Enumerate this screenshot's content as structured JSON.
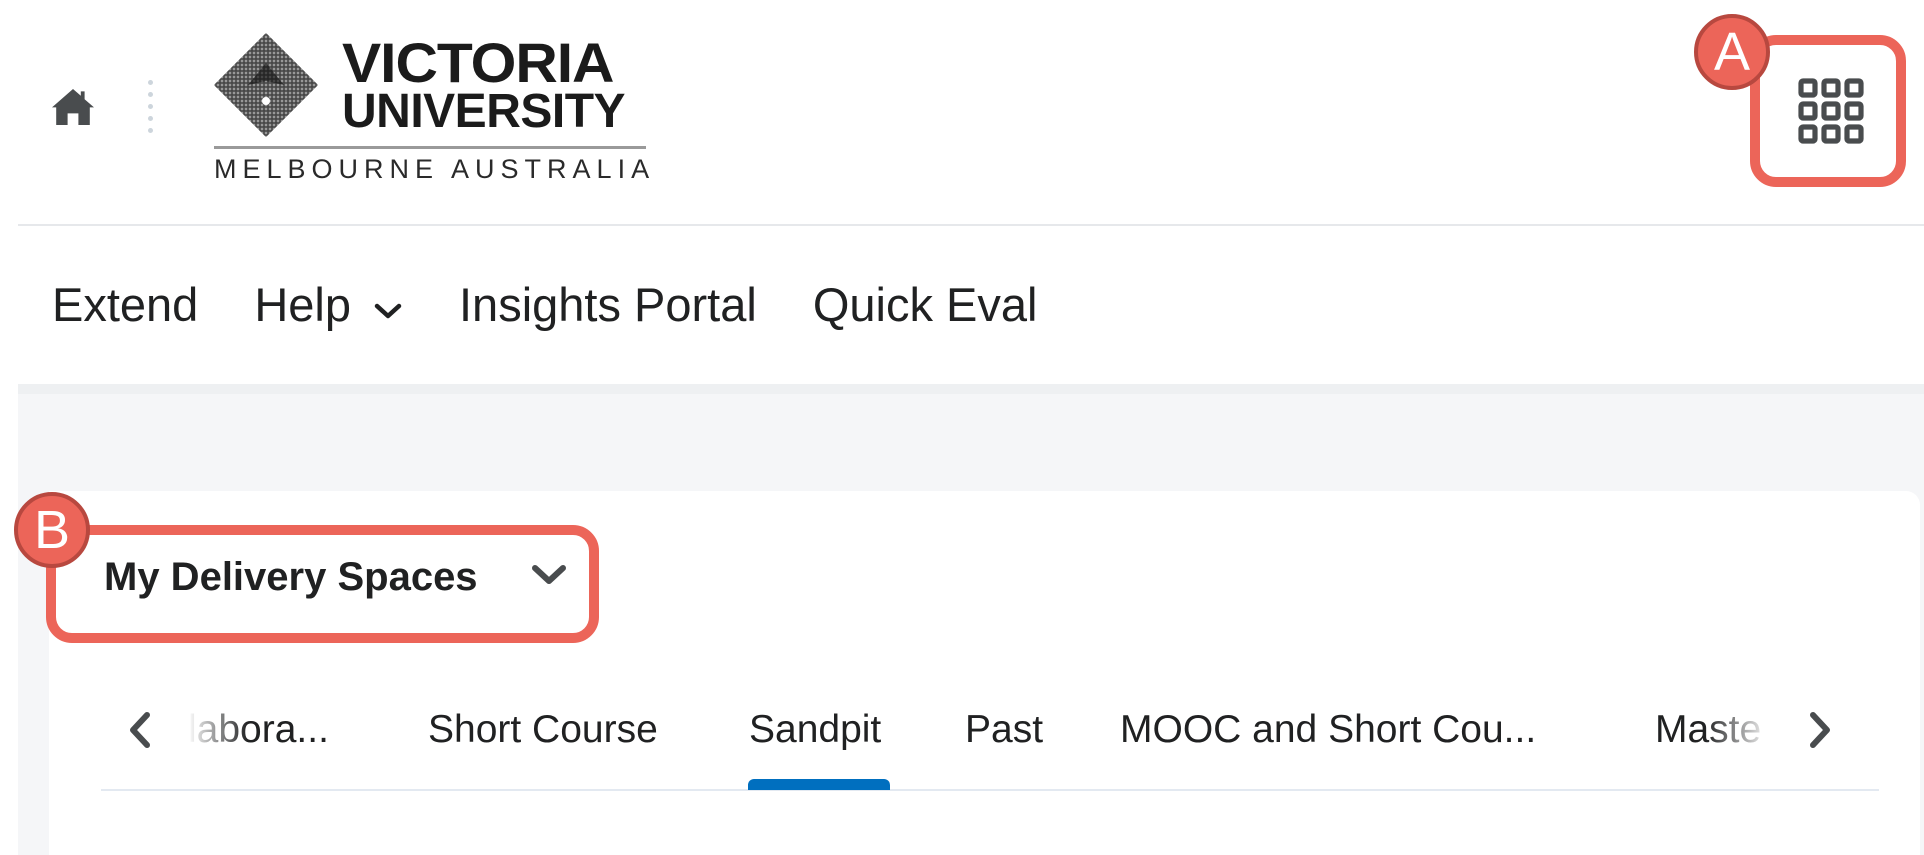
{
  "header": {
    "home_icon": "home-icon",
    "logo": {
      "line1": "VICTORIA",
      "line2": "UNIVERSITY",
      "subtitle": "MELBOURNE AUSTRALIA"
    },
    "apps_icon": "grid-icon"
  },
  "nav": {
    "items": [
      {
        "label": "Extend",
        "has_dropdown": false
      },
      {
        "label": "Help",
        "has_dropdown": true
      },
      {
        "label": "Insights Portal",
        "has_dropdown": false
      },
      {
        "label": "Quick Eval",
        "has_dropdown": false
      }
    ]
  },
  "widget": {
    "title": "My Delivery Spaces",
    "tabs": [
      {
        "label": "labora...",
        "active": false,
        "partial": "left"
      },
      {
        "label": "Short Course",
        "active": false
      },
      {
        "label": "Sandpit",
        "active": true
      },
      {
        "label": "Past",
        "active": false
      },
      {
        "label": "MOOC and Short Cou...",
        "active": false
      },
      {
        "label": "Maste",
        "active": false,
        "partial": "right"
      }
    ],
    "active_tab_color": "#006fbf"
  },
  "annotations": {
    "a_label": "A",
    "b_label": "B",
    "color": "#ec6559"
  }
}
